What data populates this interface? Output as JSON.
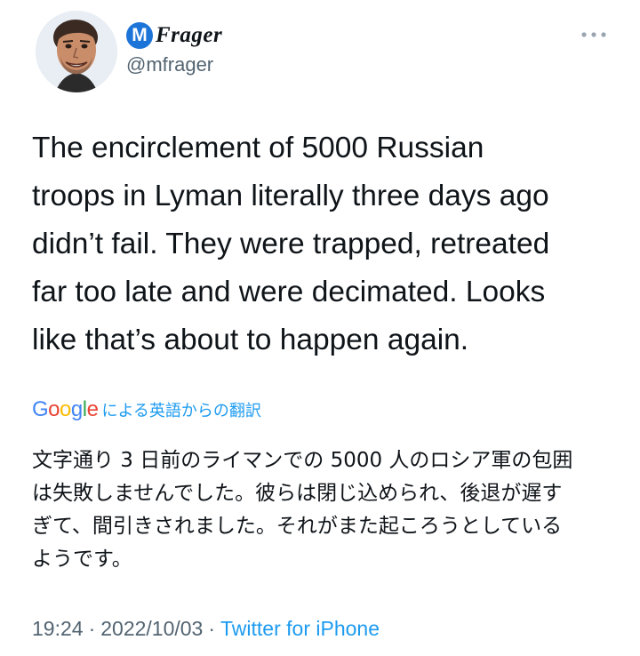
{
  "author": {
    "badge_letter": "M",
    "display_name": "Frager",
    "handle": "@mfrager",
    "badge_color": "#1d74d8"
  },
  "tweet": {
    "text": "The encirclement of 5000 Russian\ntroops in Lyman literally three days ago\ndidn’t fail. They were trapped, retreated\nfar too late and were decimated. Looks\nlike that’s about to happen again.",
    "translation_provider": "Google",
    "translation_label": "による英語からの翻訳",
    "translated_text": "文字通り 3 日前のライマンでの 5000 人のロシア軍の包囲\nは失敗しませんでした。彼らは閉じ込められ、後退が遅す\nぎて、間引きされました。それがまた起ころうとしている\nようです。"
  },
  "meta": {
    "time": "19:24",
    "separator": "·",
    "date": "2022/10/03",
    "source": "Twitter for iPhone"
  },
  "icons": {
    "more": "more-dots-icon",
    "avatar": "avatar-image"
  },
  "colors": {
    "link": "#1d9bf0",
    "secondary": "#536471",
    "text": "#0f1419",
    "google_blue": "#4285F4",
    "google_red": "#EA4335",
    "google_yellow": "#FBBC05",
    "google_green": "#34A853"
  }
}
